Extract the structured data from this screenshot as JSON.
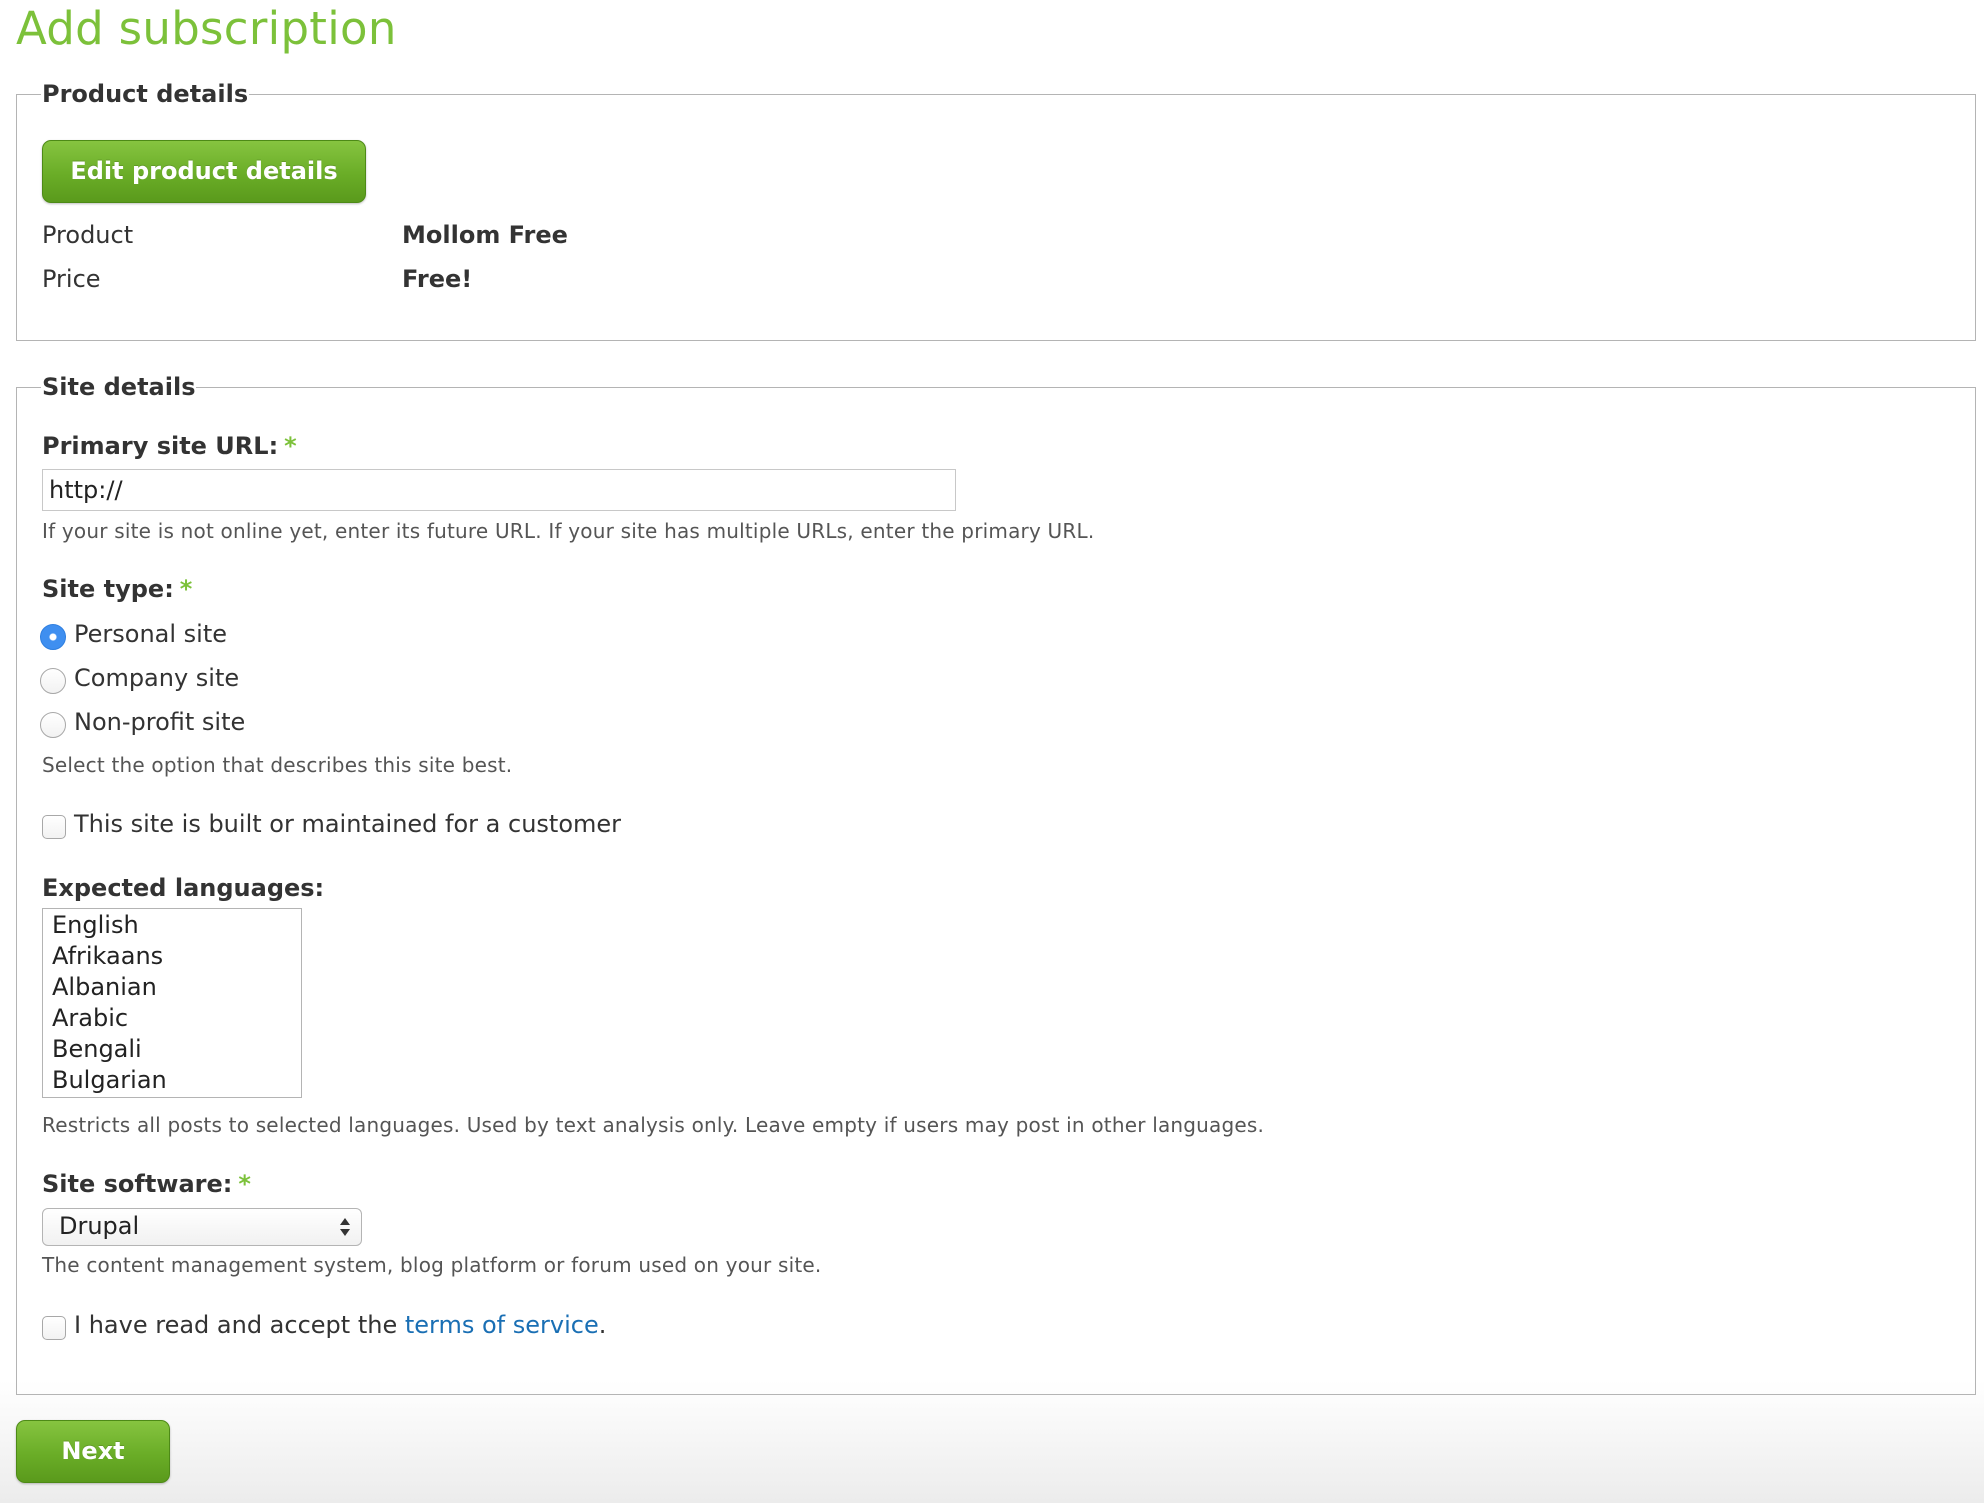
{
  "page": {
    "title": "Add subscription"
  },
  "product_details": {
    "legend": "Product details",
    "edit_button": "Edit product details",
    "rows": [
      {
        "label": "Product",
        "value": "Mollom Free"
      },
      {
        "label": "Price",
        "value": "Free!"
      }
    ]
  },
  "site_details": {
    "legend": "Site details",
    "url": {
      "label": "Primary site URL:",
      "required_mark": "*",
      "value": "http://",
      "description": "If your site is not online yet, enter its future URL. If your site has multiple URLs, enter the primary URL."
    },
    "site_type": {
      "label": "Site type:",
      "required_mark": "*",
      "options": [
        "Personal site",
        "Company site",
        "Non-profit site"
      ],
      "selected": "Personal site",
      "description": "Select the option that describes this site best."
    },
    "customer_checkbox": {
      "label": "This site is built or maintained for a customer",
      "checked": false
    },
    "languages": {
      "label": "Expected languages:",
      "options": [
        "English",
        "Afrikaans",
        "Albanian",
        "Arabic",
        "Bengali",
        "Bulgarian"
      ],
      "description": "Restricts all posts to selected languages. Used by text analysis only. Leave empty if users may post in other languages."
    },
    "software": {
      "label": "Site software:",
      "required_mark": "*",
      "selected": "Drupal",
      "description": "The content management system, blog platform or forum used on your site."
    },
    "terms": {
      "prefix": "I have read and accept the ",
      "link": "terms of service",
      "suffix": ".",
      "checked": false
    }
  },
  "actions": {
    "next_button": "Next"
  },
  "colors": {
    "accent_green": "#7cc13a",
    "button_green": "#6aad27",
    "link_blue": "#1a6fb4",
    "radio_blue": "#3f8ff0"
  }
}
